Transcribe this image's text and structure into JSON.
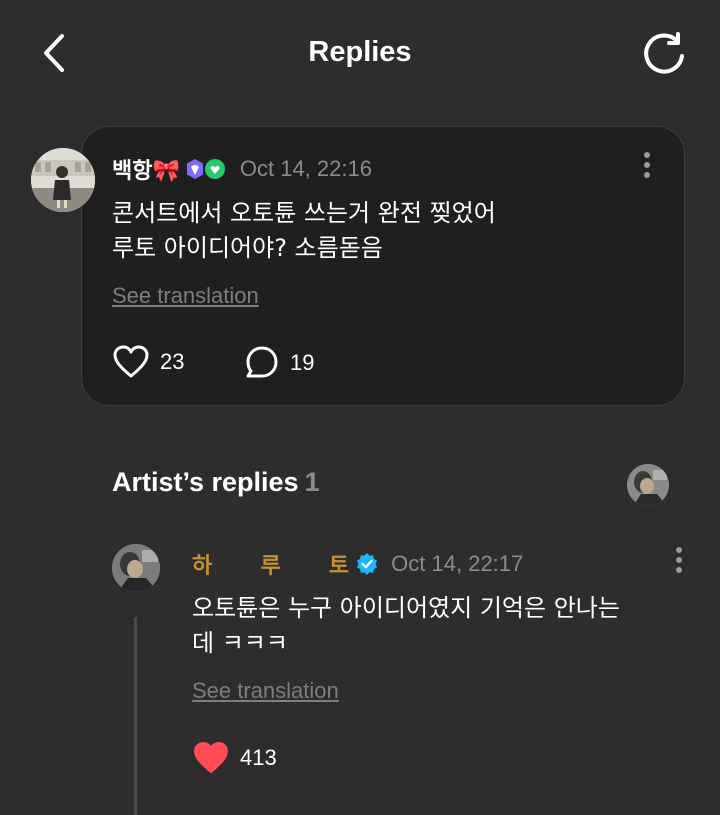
{
  "header": {
    "title": "Replies"
  },
  "comment": {
    "username": "백항🎀",
    "timestamp": "Oct 14, 22:16",
    "text": "콘서트에서 오토튠 쓰는거 완전 찢었어\n루토 아이디어야? 소름돋음",
    "see_translation": "See translation",
    "likes": "23",
    "replies": "19"
  },
  "artist_replies": {
    "title": "Artist’s replies",
    "count": "1",
    "reply": {
      "username": "하  루  토",
      "timestamp": "Oct 14, 22:17",
      "text": "오토튠은 누구 아이디어였지 기억은 안나는\n데 ㅋㅋㅋ",
      "see_translation": "See translation",
      "likes": "413"
    }
  },
  "colors": {
    "background": "#2d2d2d",
    "card": "#1f1f1f",
    "artist_name": "#c8902f",
    "liked_heart": "#ff4d55",
    "verified_badge": "#1fb6ff"
  },
  "icons": [
    "back-arrow-icon",
    "refresh-icon",
    "more-vertical-icon",
    "heart-icon",
    "comment-icon",
    "verified-icon",
    "membership-badge-icon"
  ]
}
